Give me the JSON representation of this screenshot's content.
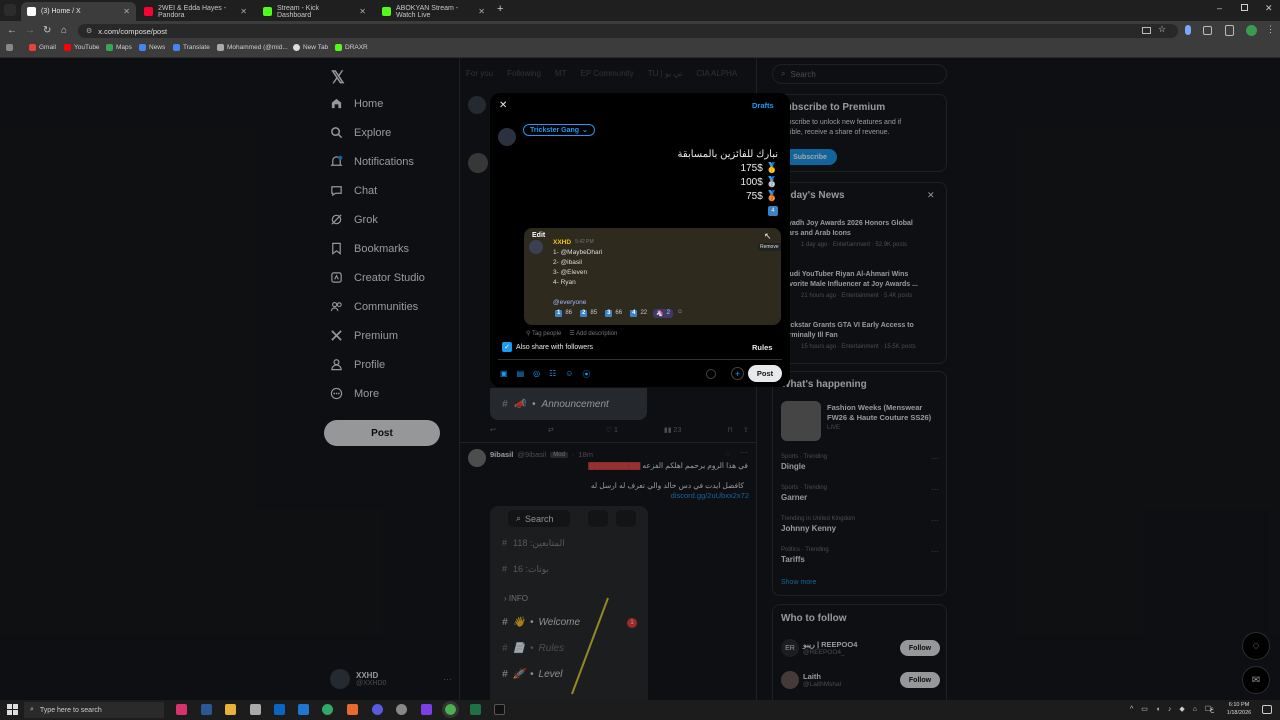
{
  "browser": {
    "tabs": [
      {
        "title": "(3) Home / X",
        "active": true,
        "color": "#ffffff"
      },
      {
        "title": "2WEI & Edda Hayes - Pandora",
        "active": false,
        "color": "#ff0033"
      },
      {
        "title": "Stream - Kick Dashboard",
        "active": false,
        "color": "#53fc18"
      },
      {
        "title": "ABOKYAN Stream - Watch Live",
        "active": false,
        "color": "#53fc18"
      }
    ],
    "url": "x.com/compose/post",
    "bookmarks": [
      "Gmail",
      "YouTube",
      "Maps",
      "News",
      "Translate",
      "Mohammed (@mid...",
      "New Tab",
      "DRAXR"
    ]
  },
  "sidebar": {
    "items": [
      {
        "label": "Home",
        "icon": "home-icon"
      },
      {
        "label": "Explore",
        "icon": "search-icon"
      },
      {
        "label": "Notifications",
        "icon": "bell-icon"
      },
      {
        "label": "Chat",
        "icon": "chat-icon"
      },
      {
        "label": "Grok",
        "icon": "grok-icon"
      },
      {
        "label": "Bookmarks",
        "icon": "bookmark-icon"
      },
      {
        "label": "Creator Studio",
        "icon": "creator-icon"
      },
      {
        "label": "Communities",
        "icon": "communities-icon"
      },
      {
        "label": "Premium",
        "icon": "x-icon"
      },
      {
        "label": "Profile",
        "icon": "profile-icon"
      },
      {
        "label": "More",
        "icon": "more-icon"
      }
    ],
    "post_button": "Post",
    "account": {
      "name": "XXHD",
      "handle": "@XXHD0"
    }
  },
  "timeline": {
    "tabs": [
      "For you",
      "Following",
      "MT",
      "EP Community",
      "TU | تي يو",
      "CIA ALPHA"
    ],
    "announcement": "Announcement",
    "post_actions": {
      "likes": "1",
      "views": "23"
    },
    "post2": {
      "author": "9ibasil",
      "handle": "@9ibasil",
      "badge": "Mod",
      "time": "18m",
      "line1": "في هذا الروم يرحمم اهلكم الفزعه",
      "line2": "كافضل ايدت في  دس خالد والي تعرف له ارسل له",
      "link": "discord.gg/2uUbxx2x72"
    },
    "discord": {
      "search": "Search",
      "followers": "المتابعين: 118",
      "posts": "بوتات: 16",
      "info": "INFO",
      "channels": [
        "Welcome",
        "Rules",
        "Level"
      ],
      "welcome_badge": "1"
    }
  },
  "right": {
    "search_placeholder": "Search",
    "premium": {
      "title": "Subscribe to Premium",
      "body1": "Subscribe to unlock new features and if",
      "body2": "eligible, receive a share of revenue.",
      "button": "Subscribe"
    },
    "news": {
      "title": "Today's News",
      "items": [
        {
          "title1": "Riyadh Joy Awards 2026 Honors Global",
          "title2": "Stars and Arab Icons",
          "meta": "1 day ago · Entertainment · 52.9K posts"
        },
        {
          "title1": "Saudi YouTuber Riyan Al-Ahmari Wins",
          "title2": "Favorite Male Influencer at Joy Awards ...",
          "meta": "21 hours ago · Entertainment · 5.4K posts"
        },
        {
          "title1": "Rockstar Grants GTA VI Early Access to",
          "title2": "Terminally Ill Fan",
          "meta": "15 hours ago · Entertainment · 15.5K posts"
        }
      ]
    },
    "happening": {
      "title": "What's happening",
      "event": {
        "title1": "Fashion Weeks (Menswear",
        "title2": "FW26 & Haute Couture SS26)",
        "status": "LIVE"
      },
      "trends": [
        {
          "context": "Sports · Trending",
          "name": "Dingle"
        },
        {
          "context": "Sports · Trending",
          "name": "Garner"
        },
        {
          "context": "Trending in United Kingdom",
          "name": "Johnny Kenny"
        },
        {
          "context": "Politics · Trending",
          "name": "Tariffs"
        }
      ],
      "show_more": "Show more"
    },
    "who_to_follow": {
      "title": "Who to follow",
      "accounts": [
        {
          "name": "ريبو | REEPOO4",
          "handle": "@REEPOO4_",
          "button": "Follow"
        },
        {
          "name": "Laith",
          "handle": "@LaithMshal",
          "button": "Follow"
        }
      ]
    }
  },
  "compose": {
    "drafts": "Drafts",
    "audience": "Trickster Gang",
    "text_lines": [
      "نبارك للفائزين بالمسابقة",
      "175$ 🥇",
      "100$ 🥈",
      "75$ 🥉"
    ],
    "number_tag": "4",
    "attachment": {
      "edit": "Edit",
      "remove": "Remove",
      "author": "XXHD",
      "time": "5:42 PM",
      "lines": [
        "1- @MaybeDhari",
        "2- @ibasil",
        "3- @Eleven",
        "4- Ryan"
      ],
      "mention": "@everyone",
      "reactions": [
        {
          "emoji": "1",
          "count": "86"
        },
        {
          "emoji": "2",
          "count": "85"
        },
        {
          "emoji": "3",
          "count": "66"
        },
        {
          "emoji": "4",
          "count": "22"
        },
        {
          "emoji": "🦄",
          "count": "2"
        }
      ]
    },
    "tag_people": "Tag people",
    "add_description": "Add description",
    "share_followers": "Also share with followers",
    "rules": "Rules",
    "post_button": "Post"
  },
  "taskbar": {
    "search_placeholder": "Type here to search",
    "time": "6:10 PM",
    "date": "1/18/2026"
  },
  "colors": {
    "accent": "#1d9bf0",
    "discord_purple": "#5865f2"
  }
}
